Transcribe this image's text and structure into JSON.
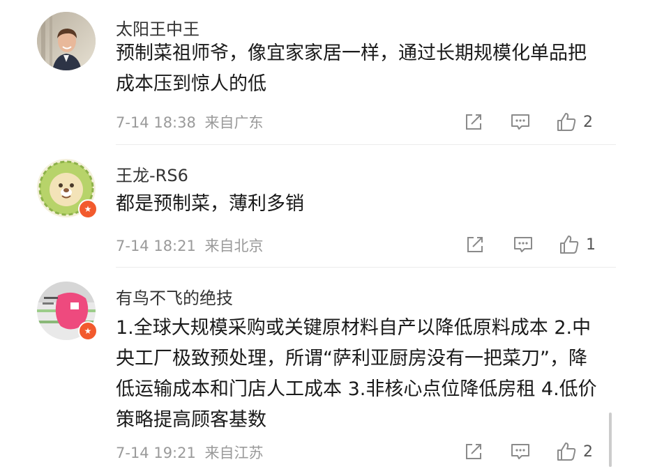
{
  "comments": [
    {
      "user": "太阳王中王",
      "text": "预制菜祖师爷，像宜家家居一样，通过长期规模化单品把成本压到惊人的低",
      "time": "7-14 18:38",
      "location": "来自广东",
      "likes": "2",
      "avatar_icon": "person-photo-avatar",
      "has_badge": false
    },
    {
      "user": "王龙-RS6",
      "text": "都是预制菜，薄利多销",
      "time": "7-14 18:21",
      "location": "来自北京",
      "likes": "1",
      "avatar_icon": "lion-cartoon-avatar",
      "has_badge": true
    },
    {
      "user": "有鸟不飞的绝技",
      "text": "1.全球大规模采购或关键原材料自产以降低原料成本 2.中央工厂极致预处理，所谓“萨利亚厨房没有一把菜刀”，降低运输成本和门店人工成本 3.非核心点位降低房租 4.低价策略提高顾客基数",
      "time": "7-14 19:21",
      "location": "来自江苏",
      "likes": "2",
      "avatar_icon": "pink-graphic-avatar",
      "has_badge": true
    }
  ],
  "icons": {
    "repost": "repost-icon",
    "comment": "comment-icon",
    "like": "thumbs-up-icon",
    "badge": "star-badge-icon"
  },
  "colors": {
    "badge": "#f25a2d",
    "meta_text": "#9a9a9a",
    "icon_stroke": "#8a8a8a"
  }
}
